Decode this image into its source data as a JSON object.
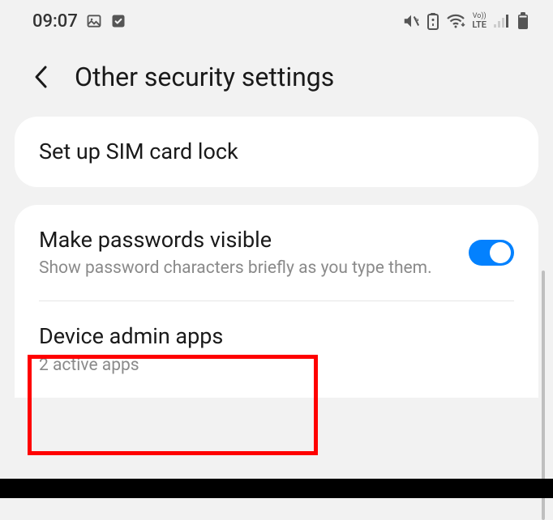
{
  "statusBar": {
    "time": "09:07"
  },
  "header": {
    "title": "Other security settings"
  },
  "items": {
    "simLock": {
      "title": "Set up SIM card lock"
    },
    "passwordsVisible": {
      "title": "Make passwords visible",
      "subtitle": "Show password characters briefly as you type them."
    },
    "deviceAdmin": {
      "title": "Device admin apps",
      "subtitle": "2 active apps"
    }
  },
  "network": {
    "vo": "Vo))",
    "lte": "LTE"
  }
}
